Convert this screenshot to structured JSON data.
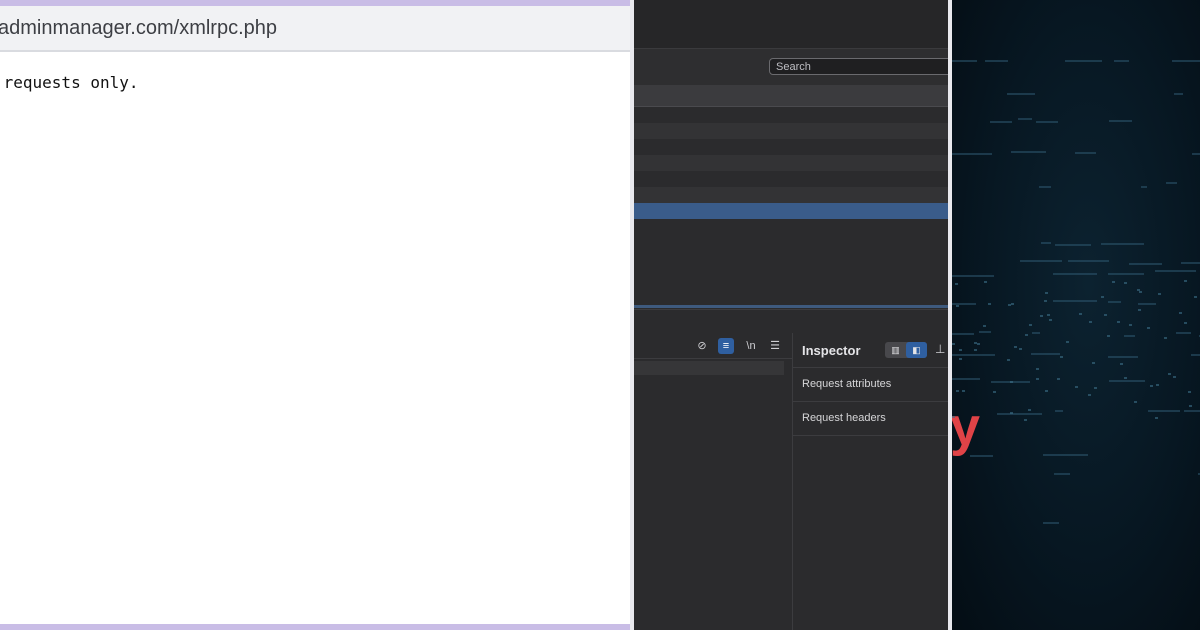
{
  "browser": {
    "url": "adminmanager.com/xmlrpc.php",
    "message": " requests only."
  },
  "devtools": {
    "search_placeholder": "Search",
    "rows": [
      {
        "state": "normal"
      },
      {
        "state": "alt"
      },
      {
        "state": "normal"
      },
      {
        "state": "alt"
      },
      {
        "state": "normal"
      },
      {
        "state": "alt"
      },
      {
        "state": "selected"
      }
    ],
    "toolbar_icons": [
      {
        "icon": "hide-eye-icon",
        "glyph": "⊘"
      },
      {
        "icon": "wrap-lines-icon",
        "glyph": "≡"
      },
      {
        "icon": "newline-icon",
        "glyph": "\\n"
      },
      {
        "icon": "menu-icon",
        "glyph": "☰"
      }
    ],
    "inspector": {
      "title": "Inspector",
      "view_toggle_icons": [
        "list-view-icon",
        "split-view-icon"
      ],
      "items": [
        "Request attributes",
        "Request headers"
      ]
    }
  },
  "overlay": {
    "accent_text": "y",
    "accent_color": "#e04347"
  },
  "colors": {
    "browser_accent": "#c9bde6",
    "devtools_bg": "#2b2b2d",
    "selection": "#3a5c8a",
    "dark_bg": "#071722"
  }
}
